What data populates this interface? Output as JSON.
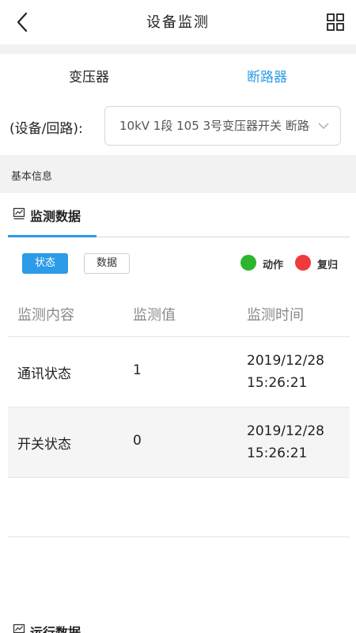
{
  "header": {
    "title": "设备监测",
    "back_icon": "chevron-left-icon",
    "menu_icon": "grid-icon"
  },
  "tabs": [
    {
      "label": "变压器",
      "active": false
    },
    {
      "label": "断路器",
      "active": true
    }
  ],
  "selector": {
    "label": "(设备/回路):",
    "value": "10kV 1段 105 3号变压器开关 断路器"
  },
  "basic_info": {
    "label": "基本信息"
  },
  "monitor_tab": {
    "label": "监测数据",
    "icon": "line-chart-icon"
  },
  "filters": {
    "status_label": "状态",
    "data_label": "数据",
    "selected": "状态"
  },
  "legend": [
    {
      "label": "动作",
      "color": "#2db52d"
    },
    {
      "label": "复归",
      "color": "#f0393b"
    }
  ],
  "table": {
    "columns": [
      "监测内容",
      "监测值",
      "监测时间"
    ],
    "rows": [
      {
        "content": "通讯状态",
        "value": "1",
        "date": "2019/12/28",
        "time": "15:26:21"
      },
      {
        "content": "开关状态",
        "value": "0",
        "date": "2019/12/28",
        "time": "15:26:21"
      }
    ]
  },
  "run_tab": {
    "label": "运行数据",
    "icon": "line-chart-icon"
  },
  "colors": {
    "accent": "#2c9be8",
    "divider": "#f2f2f2"
  }
}
